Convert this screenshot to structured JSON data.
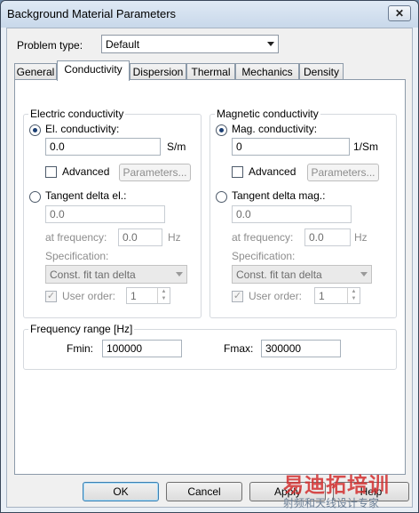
{
  "window": {
    "title": "Background Material Parameters",
    "close_glyph": "✕"
  },
  "problem_type": {
    "label": "Problem type:",
    "value": "Default"
  },
  "tabs": [
    {
      "label": "General",
      "active": false
    },
    {
      "label": "Conductivity",
      "active": true
    },
    {
      "label": "Dispersion",
      "active": false
    },
    {
      "label": "Thermal",
      "active": false
    },
    {
      "label": "Mechanics",
      "active": false
    },
    {
      "label": "Density",
      "active": false
    }
  ],
  "electric": {
    "group_title": "Electric conductivity",
    "radio_conductivity": "El. conductivity:",
    "conductivity_value": "0.0",
    "conductivity_unit": "S/m",
    "advanced_label": "Advanced",
    "parameters_button": "Parameters...",
    "radio_tangent": "Tangent delta el.:",
    "tangent_value": "0.0",
    "frequency_label": "at frequency:",
    "frequency_value": "0.0",
    "frequency_unit": "Hz",
    "specification_label": "Specification:",
    "specification_value": "Const. fit tan delta",
    "user_order_label": "User order:",
    "user_order_value": "1"
  },
  "magnetic": {
    "group_title": "Magnetic conductivity",
    "radio_conductivity": "Mag. conductivity:",
    "conductivity_value": "0",
    "conductivity_unit": "1/Sm",
    "advanced_label": "Advanced",
    "parameters_button": "Parameters...",
    "radio_tangent": "Tangent delta mag.:",
    "tangent_value": "0.0",
    "frequency_label": "at frequency:",
    "frequency_value": "0.0",
    "frequency_unit": "Hz",
    "specification_label": "Specification:",
    "specification_value": "Const. fit tan delta",
    "user_order_label": "User order:",
    "user_order_value": "1"
  },
  "frequency_range": {
    "group_title": "Frequency range [Hz]",
    "fmin_label": "Fmin:",
    "fmin_value": "100000",
    "fmax_label": "Fmax:",
    "fmax_value": "300000"
  },
  "buttons": {
    "ok": "OK",
    "cancel": "Cancel",
    "apply": "Apply",
    "help": "Help"
  },
  "watermark": {
    "top": "易迪拓培训",
    "bottom": "射频和天线设计专家"
  }
}
